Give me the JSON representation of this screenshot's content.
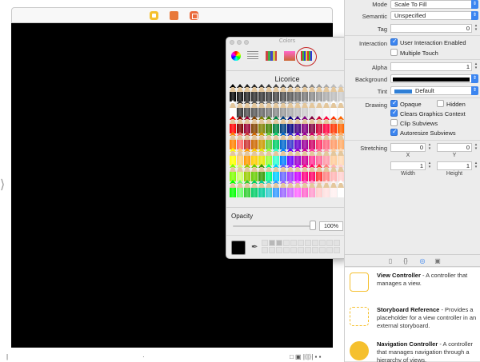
{
  "canvas": {
    "entry_arrow": "⟩",
    "bottom_left": "|",
    "bottom_mid": "·",
    "bottom_right": "□ ▣ |⟨|⟩| ▪ ▪"
  },
  "colors_panel": {
    "title": "Colors",
    "selected_color_name": "Licorice",
    "opacity_label": "Opacity",
    "opacity_value": "100%",
    "opacity_level": 1.0,
    "modes": [
      "color-wheel",
      "color-sliders",
      "color-palettes",
      "image-palettes",
      "pencils"
    ],
    "selected_mode": "pencils",
    "current_color": "#000000",
    "pencil_columns": [
      [
        "#000000",
        "#ffffff",
        "#ff0000",
        "#ff8000",
        "#ffff00",
        "#80ff00",
        "#00ff00"
      ],
      [
        "#111111",
        "#333333",
        "#800000",
        "#ff6666",
        "#ffcc66",
        "#ccff66",
        "#66ff66"
      ],
      [
        "#222222",
        "#4d4d4d",
        "#990033",
        "#cc3333",
        "#ff9900",
        "#99cc00",
        "#33cc33"
      ],
      [
        "#2b2b2b",
        "#555555",
        "#804000",
        "#cc6600",
        "#ffcc00",
        "#66cc00",
        "#00cc66"
      ],
      [
        "#333333",
        "#666666",
        "#808000",
        "#cc9900",
        "#e6e600",
        "#339900",
        "#00cc99"
      ],
      [
        "#3d3d3d",
        "#777777",
        "#408000",
        "#66cc33",
        "#99ff33",
        "#00ff80",
        "#33cccc"
      ],
      [
        "#444444",
        "#888888",
        "#008040",
        "#00cc66",
        "#33ffcc",
        "#00ccff",
        "#3399ff"
      ],
      [
        "#4d4d4d",
        "#999999",
        "#004080",
        "#0066cc",
        "#0080ff",
        "#6666ff",
        "#9966ff"
      ],
      [
        "#555555",
        "#aaaaaa",
        "#000080",
        "#3333cc",
        "#6600ff",
        "#9933ff",
        "#cc66ff"
      ],
      [
        "#666666",
        "#bbbbbb",
        "#400080",
        "#6600cc",
        "#9900cc",
        "#cc00ff",
        "#ff66ff"
      ],
      [
        "#777777",
        "#cccccc",
        "#800080",
        "#990099",
        "#cc0099",
        "#ff0080",
        "#ff66cc"
      ],
      [
        "#888888",
        "#dddddd",
        "#800040",
        "#cc0066",
        "#ff3399",
        "#ff0066",
        "#ff99cc"
      ],
      [
        "#999999",
        "#eeeeee",
        "#cc0033",
        "#ff3366",
        "#ff6699",
        "#ff3333",
        "#ffcccc"
      ],
      [
        "#aaaaaa",
        "#f5f5f5",
        "#ff0040",
        "#ff6680",
        "#ff99aa",
        "#ff8080",
        "#ffe0e0"
      ],
      [
        "#bbbbbb",
        "#ffffff",
        "#ff3300",
        "#ff9966",
        "#ffcc99",
        "#ffb3b3",
        "#fff0f0"
      ],
      [
        "#cccccc",
        "#fafafa",
        "#ff6600",
        "#ffaa66",
        "#ffd9b3",
        "#ffd0d0",
        "#ffffff"
      ]
    ]
  },
  "inspector": {
    "mode_label": "Mode",
    "mode_value": "Scale To Fill",
    "semantic_label": "Semantic",
    "semantic_value": "Unspecified",
    "tag_label": "Tag",
    "tag_value": "0",
    "interaction_label": "Interaction",
    "user_interaction_label": "User Interaction Enabled",
    "user_interaction_checked": true,
    "multiple_touch_label": "Multiple Touch",
    "multiple_touch_checked": false,
    "alpha_label": "Alpha",
    "alpha_value": "1",
    "background_label": "Background",
    "background_color": "#000000",
    "tint_label": "Tint",
    "tint_value": "Default",
    "tint_color": "#2f7fd6",
    "drawing_label": "Drawing",
    "opaque_label": "Opaque",
    "opaque_checked": true,
    "hidden_label": "Hidden",
    "hidden_checked": false,
    "clears_label": "Clears Graphics Context",
    "clears_checked": true,
    "clip_label": "Clip Subviews",
    "clip_checked": false,
    "autoresize_label": "Autoresize Subviews",
    "autoresize_checked": true,
    "stretching_label": "Stretching",
    "stretch_x": "0",
    "stretch_y": "0",
    "stretch_w": "1",
    "stretch_h": "1",
    "x_label": "X",
    "y_label": "Y",
    "width_label": "Width",
    "height_label": "Height"
  },
  "library": {
    "tabs": [
      "file-icon",
      "braces-icon",
      "object-icon",
      "media-icon"
    ],
    "items": [
      {
        "title": "View Controller",
        "description": " - A controller that manages a view.",
        "icon_color": "#f5c02e"
      },
      {
        "title": "Storyboard Reference",
        "description": " - Provides a placeholder for a view controller in an external storyboard.",
        "icon_color": "#f5c02e"
      },
      {
        "title": "Navigation Controller",
        "description": " - A controller that manages navigation through a hierarchy of views.",
        "icon_color": "#f5c02e"
      }
    ]
  }
}
